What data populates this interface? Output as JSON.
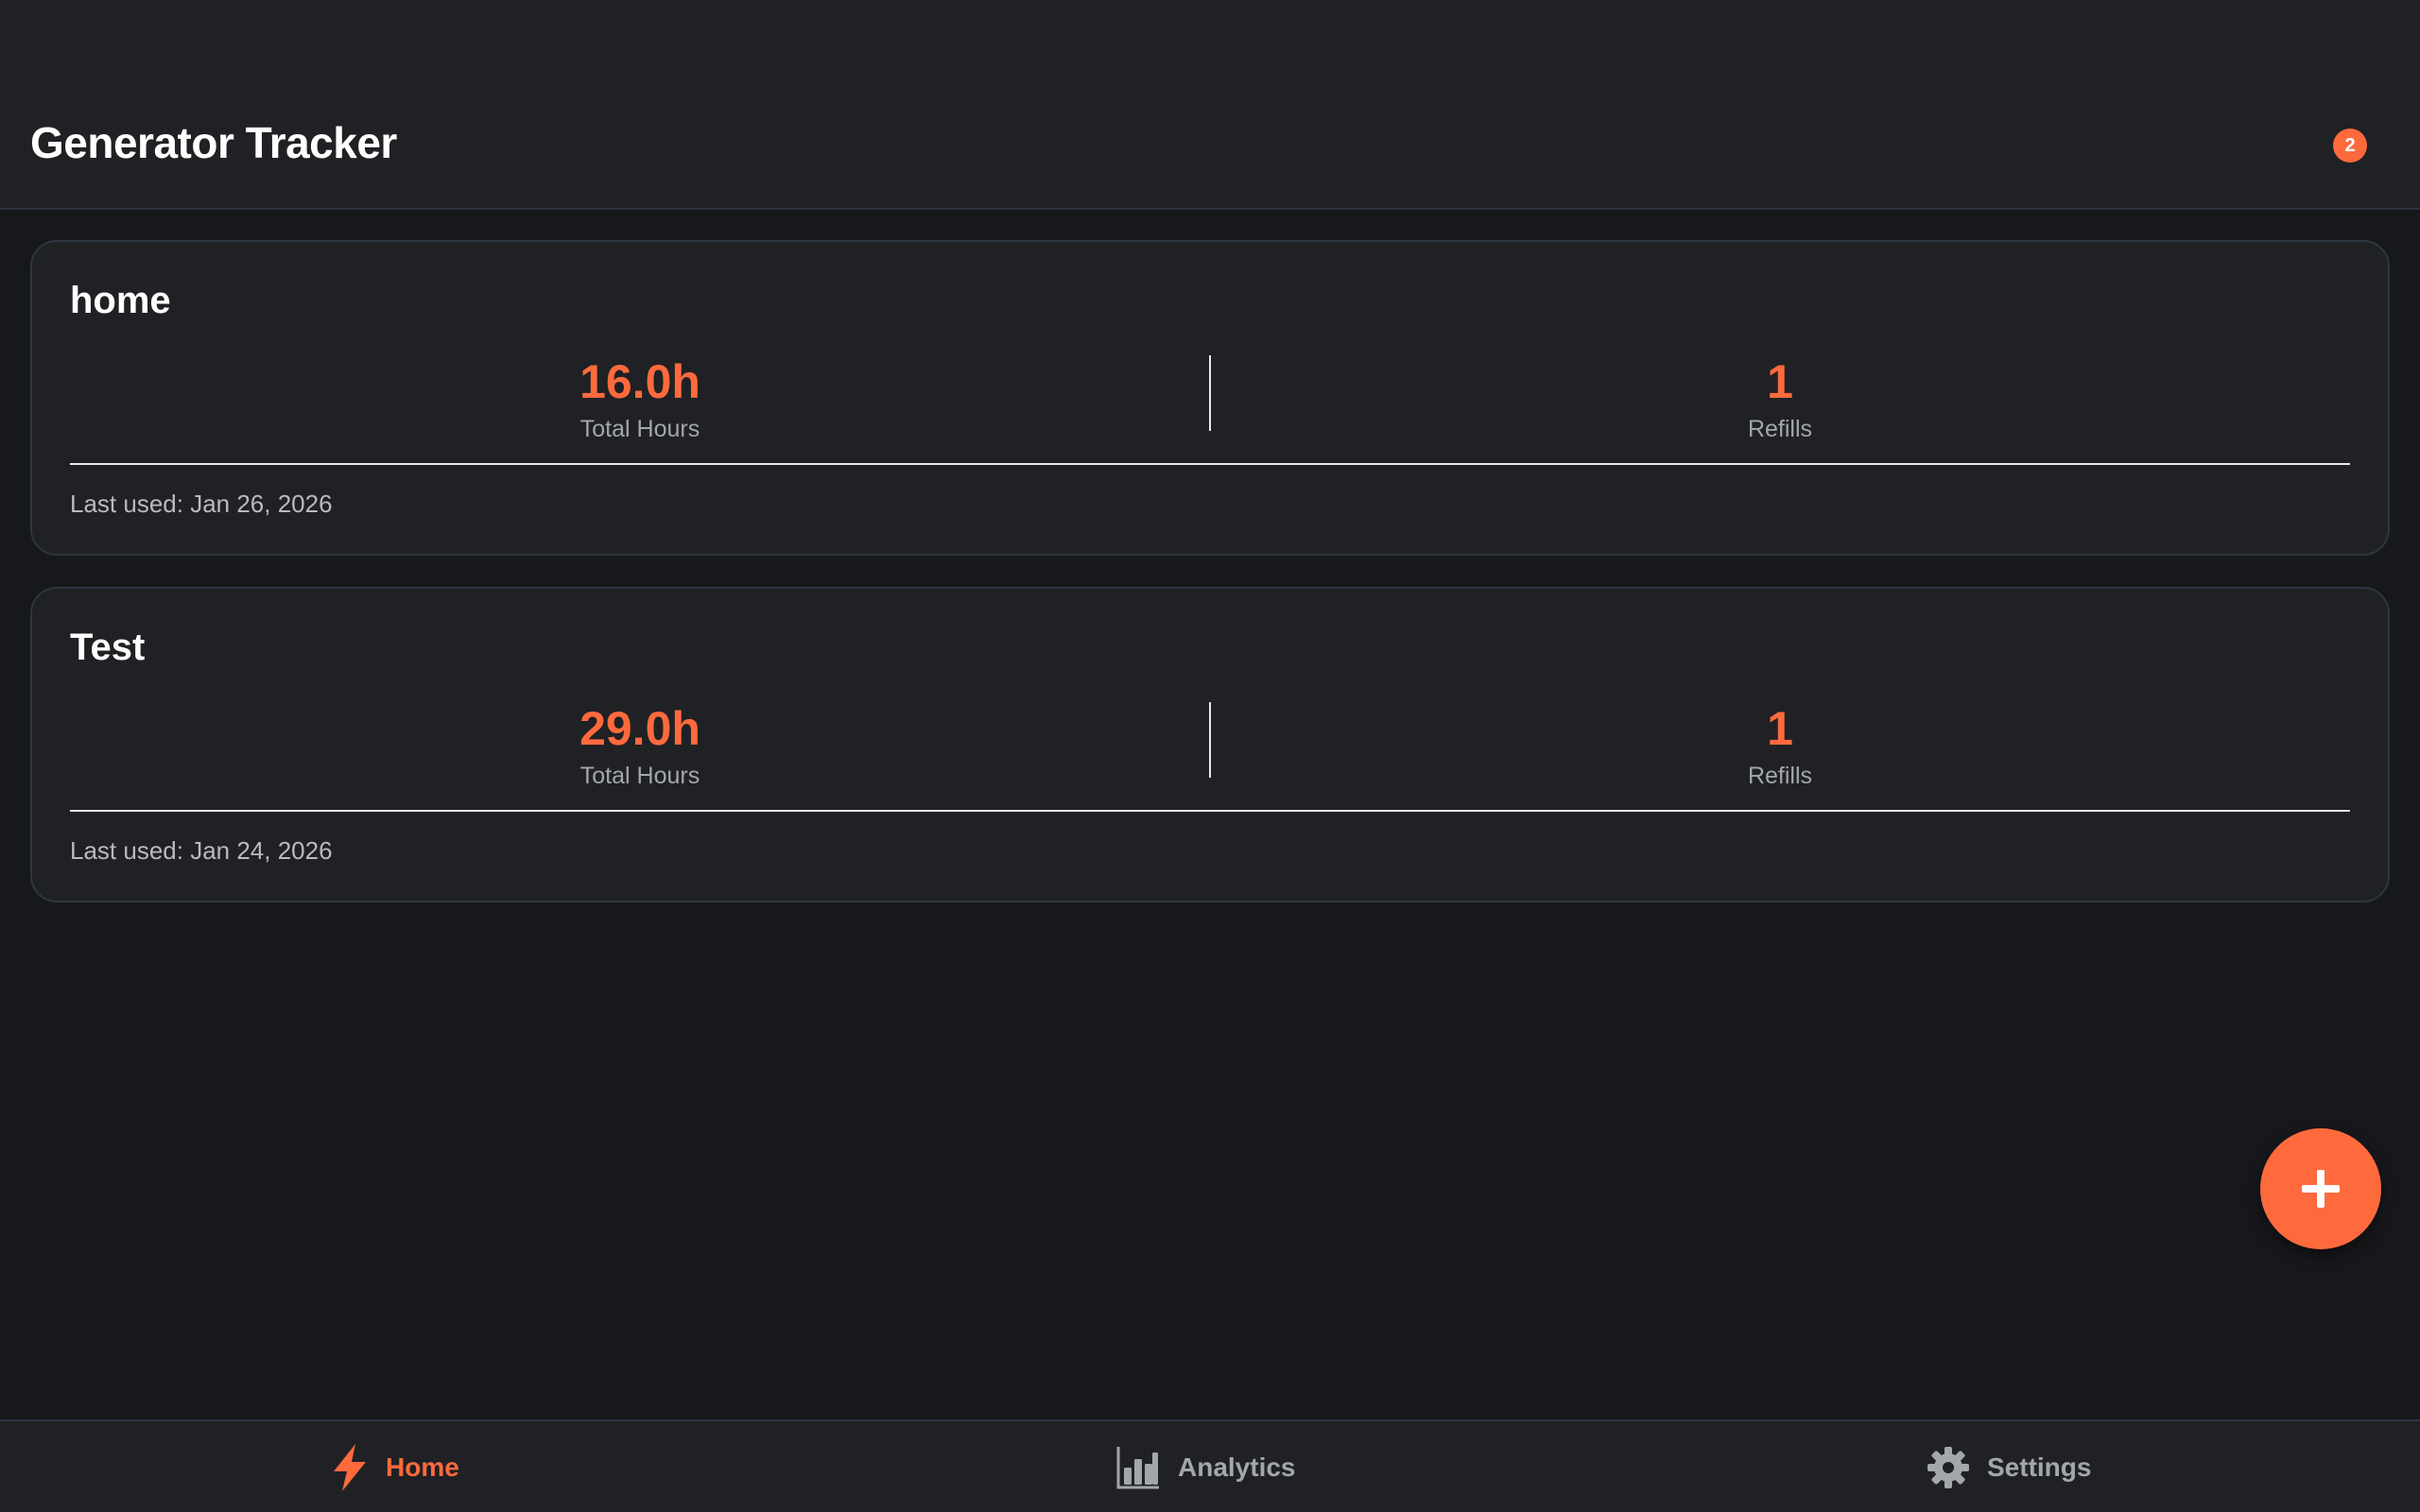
{
  "header": {
    "title": "Generator Tracker",
    "notification_count": "2"
  },
  "generators": [
    {
      "name": "home",
      "total_hours": "16.0h",
      "total_hours_label": "Total Hours",
      "refills": "1",
      "refills_label": "Refills",
      "last_used": "Last used: Jan 26, 2026"
    },
    {
      "name": "Test",
      "total_hours": "29.0h",
      "total_hours_label": "Total Hours",
      "refills": "1",
      "refills_label": "Refills",
      "last_used": "Last used: Jan 24, 2026"
    }
  ],
  "fab": {
    "icon": "plus-icon"
  },
  "nav": {
    "items": [
      {
        "label": "Home",
        "icon": "lightning-icon",
        "active": true
      },
      {
        "label": "Analytics",
        "icon": "bar-chart-icon",
        "active": false
      },
      {
        "label": "Settings",
        "icon": "gear-icon",
        "active": false
      }
    ]
  },
  "colors": {
    "accent": "#ff6a3d",
    "background": "#17181b",
    "surface": "#202124",
    "muted_text": "#a3a6ab"
  }
}
